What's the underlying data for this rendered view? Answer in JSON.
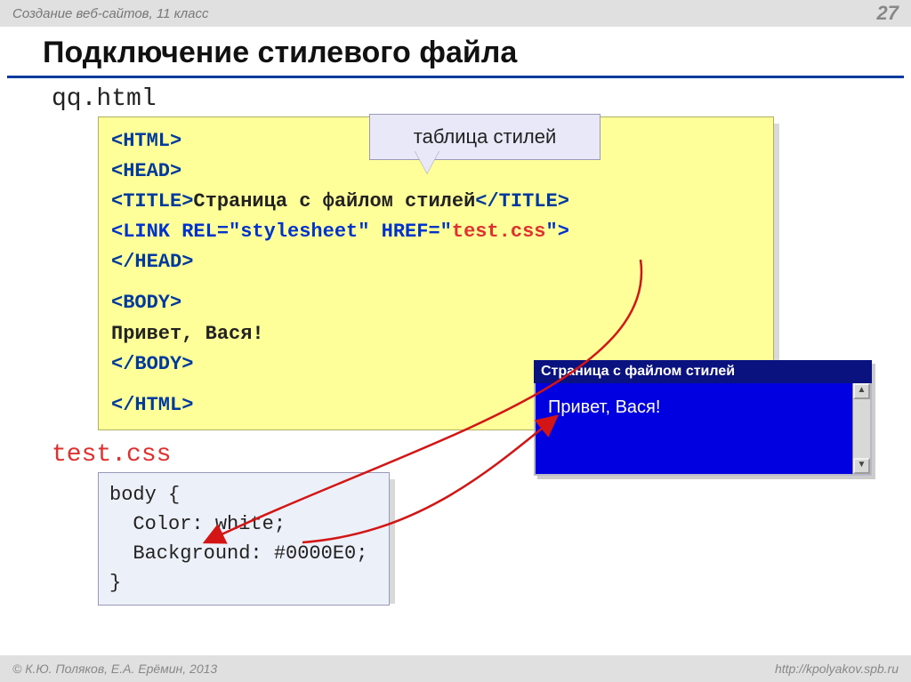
{
  "header": {
    "course": "Создание веб-сайтов, 11 класс",
    "page_number": "27"
  },
  "title": "Подключение стилевого файла",
  "html_file": {
    "name": "qq.html",
    "lines": {
      "l1": "<HTML>",
      "l2": "<HEAD>",
      "l3a": "<TITLE>",
      "l3b": "Страница с файлом стилей",
      "l3c": "</TITLE>",
      "l4a": "<LINK REL=\"stylesheet\" HREF=\"",
      "l4b": "test.css",
      "l4c": "\">",
      "l5": "</HEAD>",
      "l6": "<BODY>",
      "l7": "Привет, Вася!",
      "l8": "</BODY>",
      "l9": "</HTML>"
    }
  },
  "callout_label": "таблица стилей",
  "css_file": {
    "name": "test.css",
    "code": "body {\n  Color: white;\n  Background: #0000E0;\n}"
  },
  "browser": {
    "title": "Страница с файлом стилей",
    "body_text": "Привет, Вася!"
  },
  "footer": {
    "copyright": "© К.Ю. Поляков, Е.А. Ерёмин, 2013",
    "url": "http://kpolyakov.spb.ru"
  }
}
